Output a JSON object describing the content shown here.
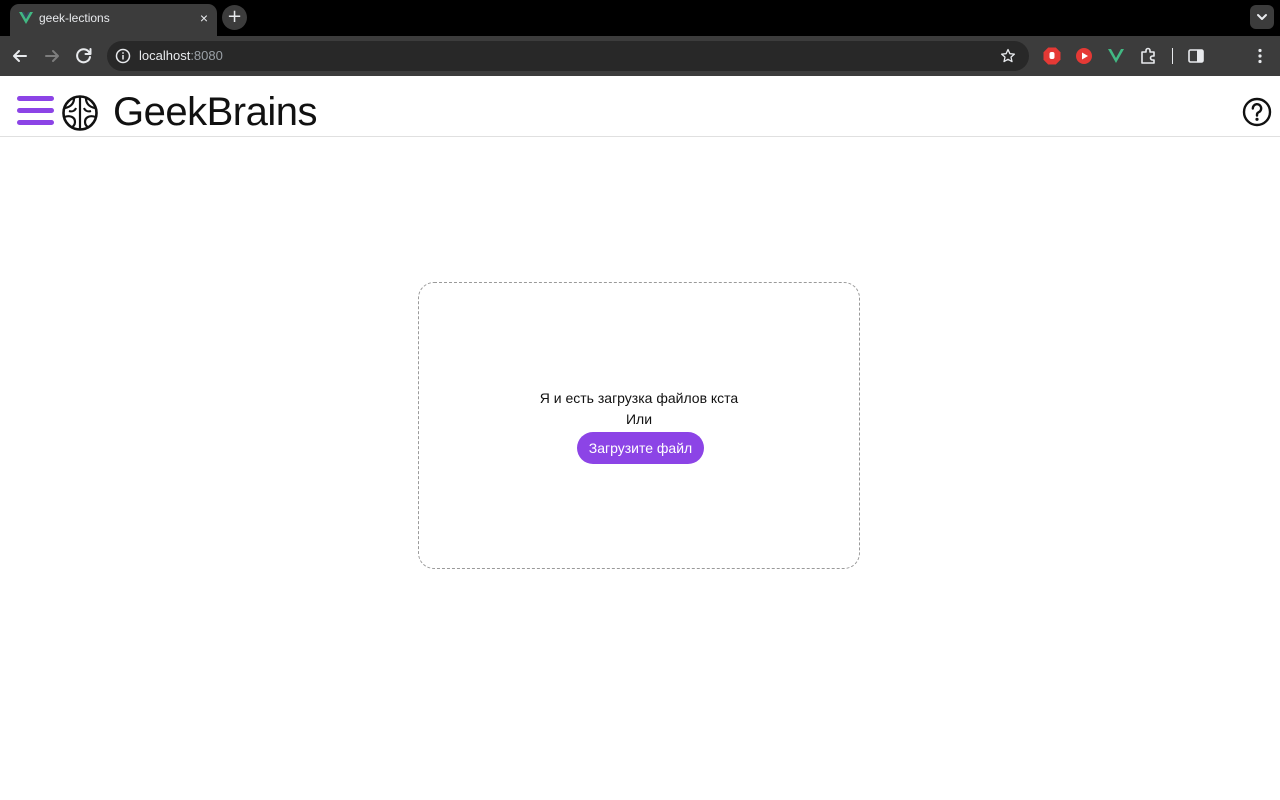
{
  "browser": {
    "tab": {
      "title": "geek-lections",
      "close": "×"
    },
    "new_tab": "+",
    "address": {
      "host": "localhost",
      "port": ":8080"
    }
  },
  "header": {
    "brand": "GeekBrains",
    "accent_color": "#8c44e6"
  },
  "upload": {
    "drop_text": "Я и есть загрузка файлов кста",
    "or_text": "Или",
    "button_label": "Загрузите файл"
  },
  "icons": [
    "vue-icon",
    "close-icon",
    "plus-icon",
    "chevron-down-icon",
    "back-arrow-icon",
    "forward-arrow-icon",
    "reload-icon",
    "info-icon",
    "star-icon",
    "stop-extension-icon",
    "youtube-extension-icon",
    "vue-devtools-icon",
    "puzzle-extensions-icon",
    "side-panel-icon",
    "kebab-menu-icon",
    "hamburger-menu-icon",
    "brain-logo-icon",
    "help-icon"
  ]
}
